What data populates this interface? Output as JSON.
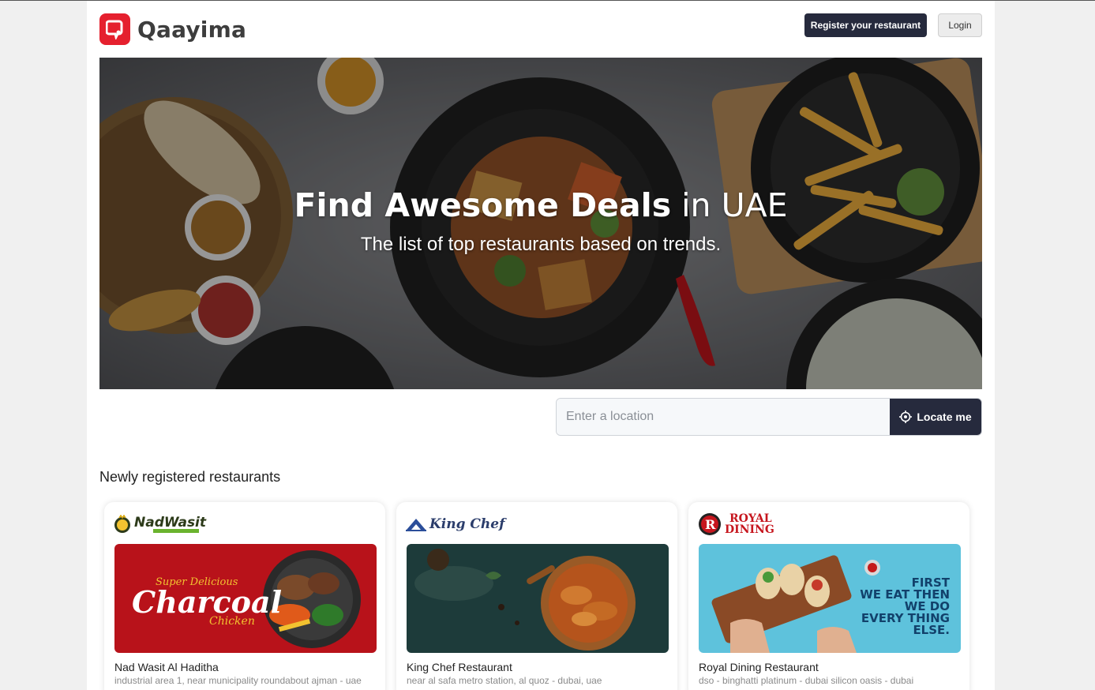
{
  "header": {
    "brand": "Qaayima",
    "register_label": "Register your restaurant",
    "login_label": "Login"
  },
  "hero": {
    "title_bold": "Find Awesome Deals",
    "title_rest": "in UAE",
    "subtitle": "The list of top restaurants based on trends."
  },
  "search": {
    "placeholder": "Enter a location",
    "value": "",
    "locate_label": "Locate me"
  },
  "section": {
    "title": "Newly registered restaurants"
  },
  "restaurants": [
    {
      "brand_text": "NadWasit",
      "name": "Nad Wasit Al Haditha",
      "address": "industrial area 1, near municipality roundabout ajman - uae",
      "image_text_1": "Super Delicious",
      "image_text_2": "Charcoal",
      "image_text_3": "Chicken"
    },
    {
      "brand_text": "King Chef",
      "name": "King Chef Restaurant",
      "address": "near al safa metro station, al quoz - dubai, uae"
    },
    {
      "brand_text_1": "ROYAL",
      "brand_text_2": "DINING",
      "name": "Royal Dining Restaurant",
      "address": "dso - binghatti platinum - dubai silicon oasis - dubai",
      "image_text": [
        "FIRST",
        "WE EAT THEN",
        "WE DO",
        "EVERY THING",
        "ELSE."
      ]
    }
  ],
  "colors": {
    "brand_red": "#e5202e",
    "dark_button": "#262a3d"
  }
}
